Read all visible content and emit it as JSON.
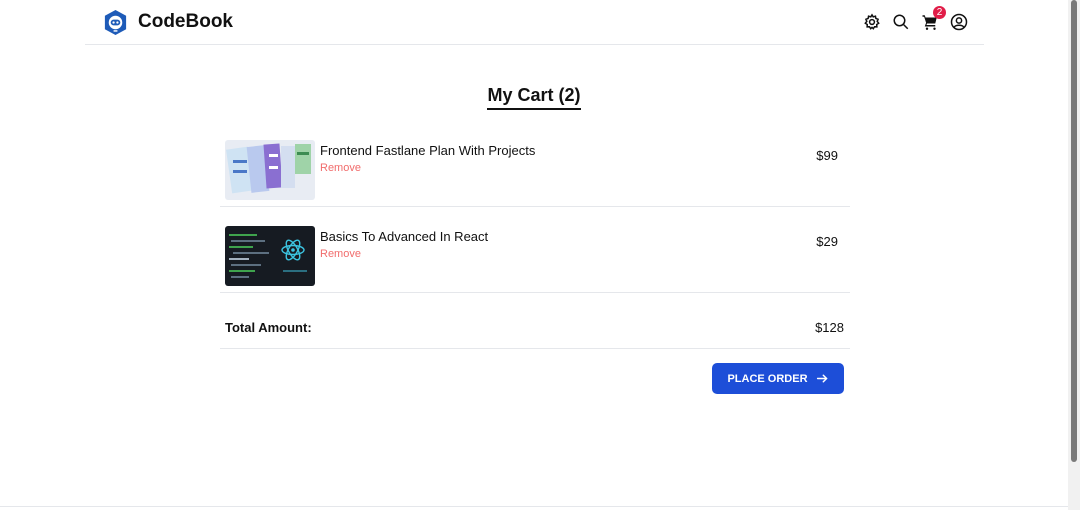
{
  "header": {
    "brand_name": "CodeBook",
    "icons": [
      "gear-icon",
      "search-icon",
      "cart-icon",
      "user-icon"
    ],
    "cart_count": "2"
  },
  "cart": {
    "title": "My Cart (2)",
    "items": [
      {
        "name": "Frontend Fastlane Plan With Projects",
        "remove_label": "Remove",
        "price": "$99"
      },
      {
        "name": "Basics To Advanced In React",
        "remove_label": "Remove",
        "price": "$29"
      }
    ],
    "total_label": "Total Amount:",
    "total_value": "$128",
    "place_order_label": "PLACE ORDER"
  },
  "colors": {
    "accent": "#1d4ed8",
    "remove": "#f16c6c",
    "badge": "#e11d48",
    "logo": "#1e5bb8"
  }
}
